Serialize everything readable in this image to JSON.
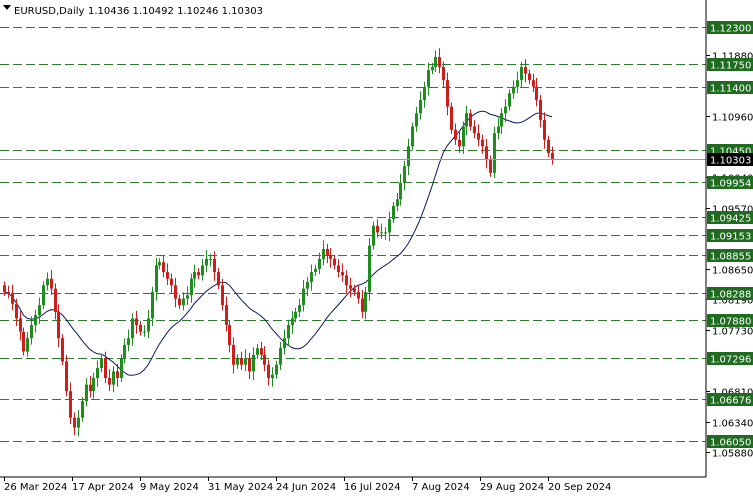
{
  "header": {
    "symbol": "EURUSD,Daily",
    "ohlc": "1.10436 1.10492 1.10246 1.10303"
  },
  "colors": {
    "bull": "#1e8c1e",
    "bear": "#d11c1c",
    "level_line": "#2f7a2f",
    "level_bg": "#1f6b1f",
    "ma": "#0d1a5c",
    "price_bg": "#000000",
    "axis_text": "#000000"
  },
  "icons": {
    "header_arrow": "triangle-down-icon"
  },
  "chart_data": {
    "type": "candlestick",
    "title": "EURUSD,Daily",
    "ylim": [
      1.057,
      1.125
    ],
    "price_ticks": [
      "1.11880",
      "1.10960",
      "1.10040",
      "1.09570",
      "1.08650",
      "1.08190",
      "1.07730",
      "1.06810",
      "1.06340",
      "1.05880"
    ],
    "levels": [
      "1.12300",
      "1.11750",
      "1.11400",
      "1.10450",
      "1.09954",
      "1.09425",
      "1.09153",
      "1.08855",
      "1.08288",
      "1.07880",
      "1.07296",
      "1.06676",
      "1.06050"
    ],
    "current_price": "1.10303",
    "dates": [
      "26 Mar 2024",
      "17 Apr 2024",
      "9 May 2024",
      "31 May 2024",
      "24 Jun 2024",
      "16 Jul 2024",
      "7 Aug 2024",
      "29 Aug 2024",
      "20 Sep 2024"
    ],
    "closes": [
      1.083,
      1.0828,
      1.0812,
      1.079,
      1.077,
      1.074,
      1.076,
      1.078,
      1.0795,
      1.081,
      1.084,
      1.085,
      1.0835,
      1.08,
      1.076,
      1.0725,
      1.068,
      1.064,
      1.0625,
      1.064,
      1.0665,
      1.069,
      1.068,
      1.07,
      1.0715,
      1.073,
      1.07,
      1.069,
      1.071,
      1.07,
      1.073,
      1.075,
      1.076,
      1.079,
      1.078,
      1.077,
      1.077,
      1.079,
      1.083,
      1.087,
      1.0875,
      1.086,
      1.085,
      1.084,
      1.082,
      1.081,
      1.082,
      1.0825,
      1.085,
      1.086,
      1.0855,
      1.087,
      1.088,
      1.088,
      1.086,
      1.084,
      1.081,
      1.078,
      1.075,
      1.072,
      1.073,
      1.072,
      1.073,
      1.071,
      1.0735,
      1.0745,
      1.0735,
      1.072,
      1.07,
      1.0705,
      1.072,
      1.0745,
      1.076,
      1.078,
      1.079,
      1.08,
      1.081,
      1.0835,
      1.0845,
      1.086,
      1.0865,
      1.088,
      1.0895,
      1.0885,
      1.088,
      1.087,
      1.086,
      1.0855,
      1.084,
      1.0835,
      1.083,
      1.082,
      1.08,
      1.083,
      1.09,
      1.093,
      1.092,
      1.092,
      1.092,
      1.094,
      1.096,
      1.097,
      1.0995,
      1.102,
      1.105,
      1.108,
      1.11,
      1.112,
      1.114,
      1.1165,
      1.117,
      1.1185,
      1.117,
      1.115,
      1.111,
      1.1075,
      1.106,
      1.105,
      1.108,
      1.11,
      1.108,
      1.107,
      1.106,
      1.105,
      1.103,
      1.101,
      1.107,
      1.108,
      1.11,
      1.111,
      1.113,
      1.114,
      1.115,
      1.117,
      1.116,
      1.115,
      1.114,
      1.112,
      1.109,
      1.106,
      1.104,
      1.103
    ],
    "ma_period": 20
  }
}
